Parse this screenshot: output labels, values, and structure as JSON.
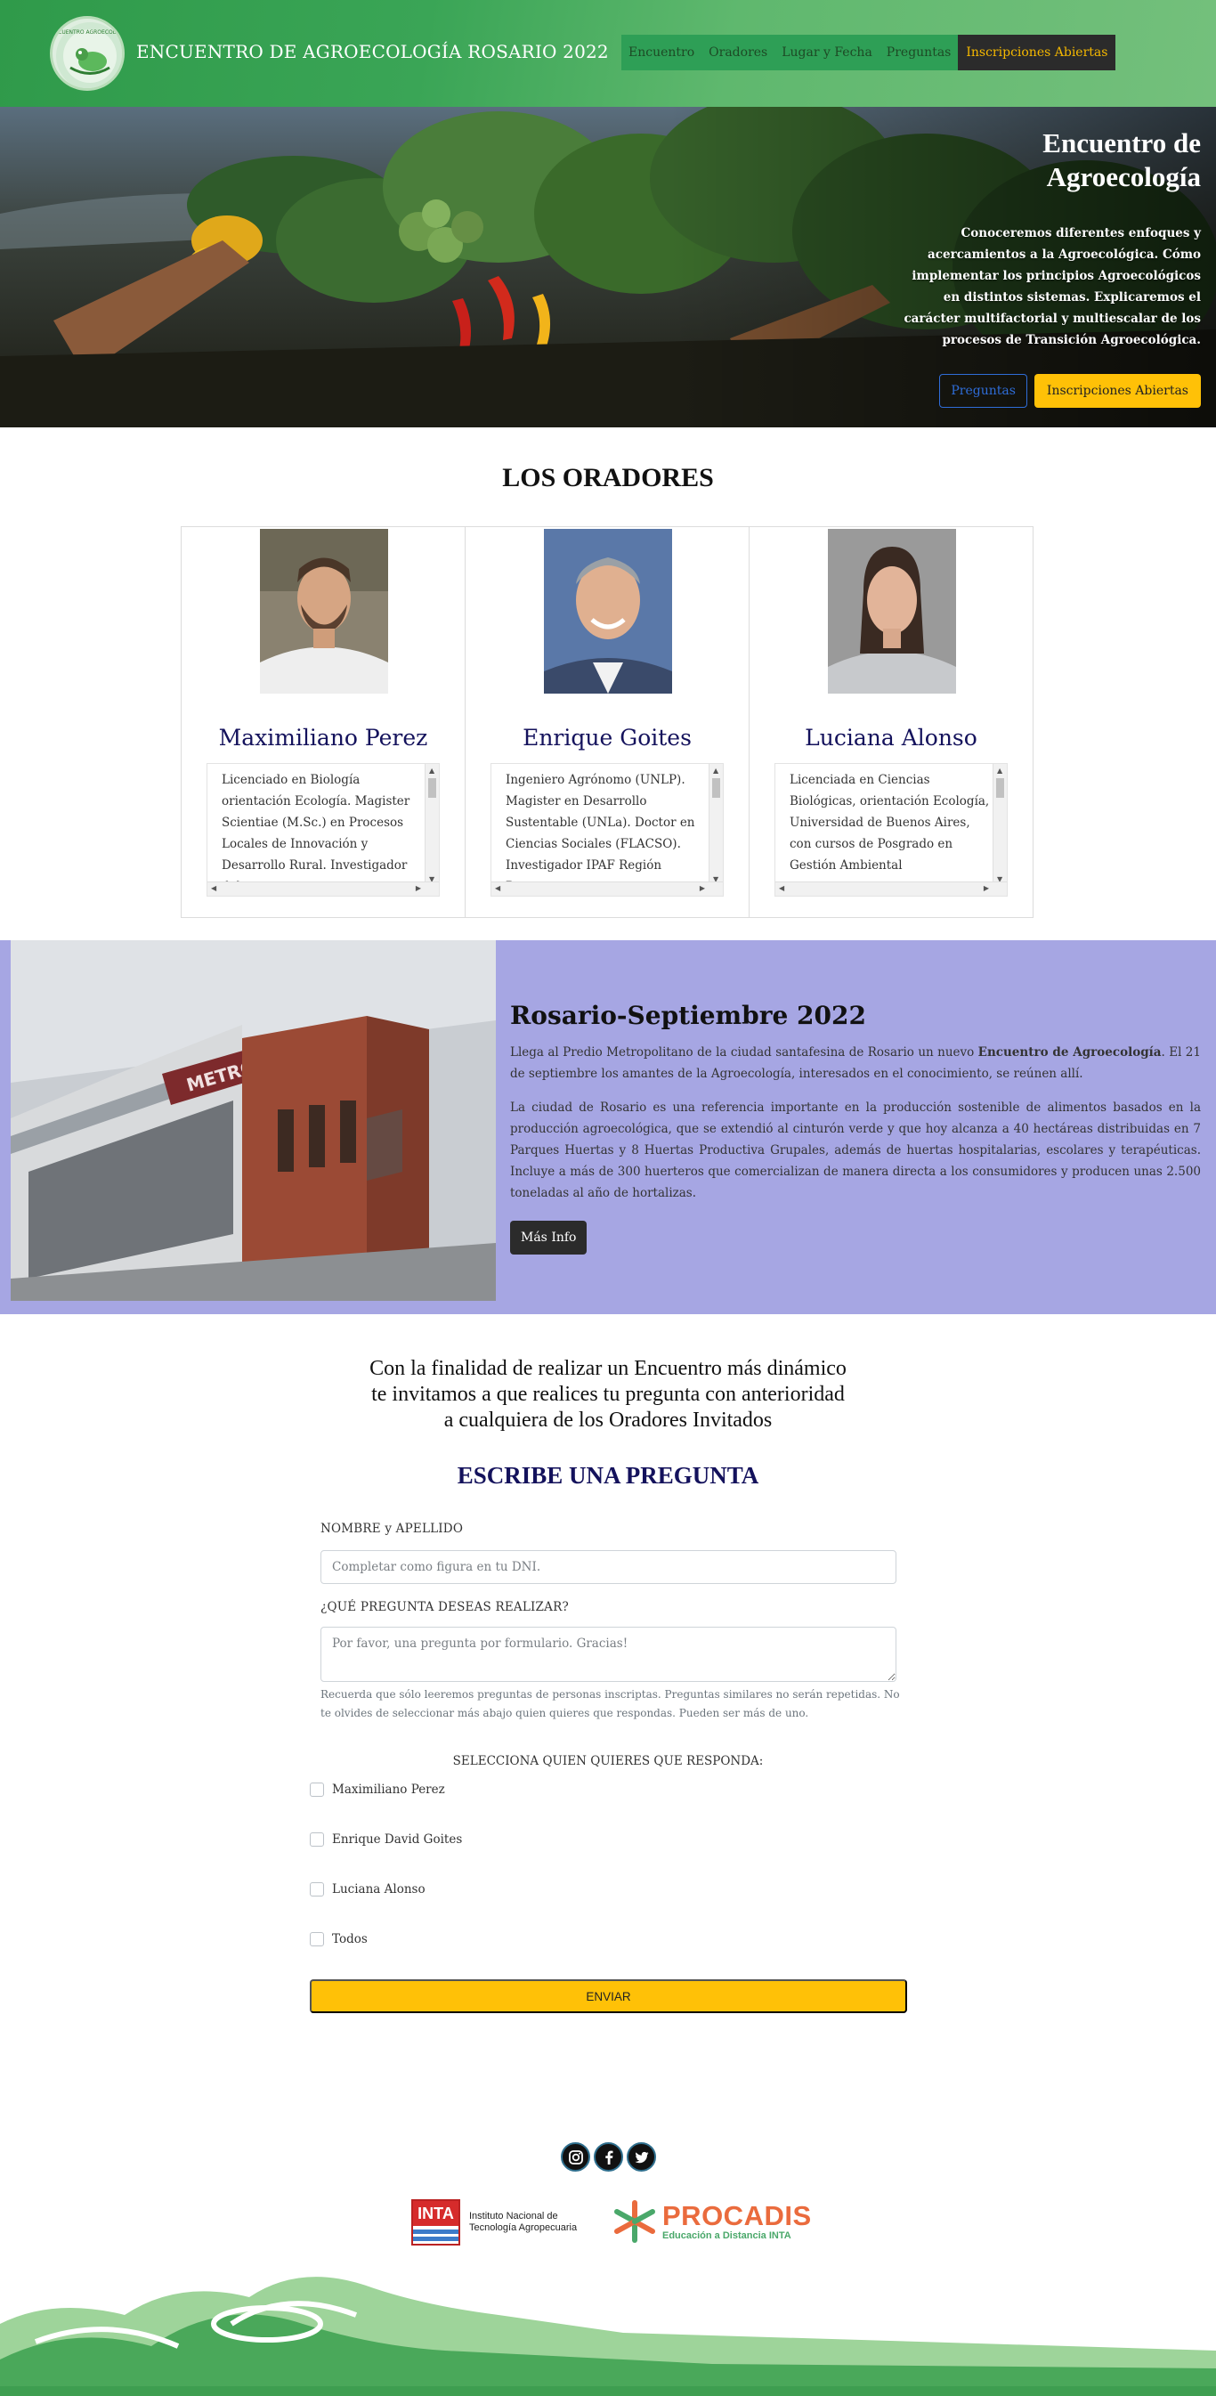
{
  "navbar": {
    "brand_title": "ENCUENTRO DE AGROECOLOGÍA ROSARIO 2022",
    "links": [
      "Encuentro",
      "Oradores",
      "Lugar y Fecha",
      "Preguntas"
    ],
    "cta_label": "Inscripciones Abiertas"
  },
  "hero": {
    "title": "Encuentro de Agroecología",
    "text": "Conoceremos diferentes enfoques y acercamientos a la Agroecológica. Cómo implementar los principios Agroecológicos en distintos sistemas. Explicaremos el carácter multifactorial y multiescalar de los procesos de Transición Agroecológica.",
    "btn_questions": "Preguntas",
    "btn_register": "Inscripciones Abiertas"
  },
  "speakers": {
    "title": "LOS ORADORES",
    "items": [
      {
        "name": "Maximiliano Perez",
        "bio": "Licenciado en Biología orientación Ecología. Magister Scientiae (M.Sc.) en Procesos Locales de Innovación y Desarrollo Rural. Investigador del"
      },
      {
        "name": "Enrique Goites",
        "bio": "Ingeniero Agrónomo (UNLP). Magister en Desarrollo Sustentable (UNLa). Doctor en Ciencias Sociales (FLACSO). Investigador IPAF Región Pampeana"
      },
      {
        "name": "Luciana Alonso",
        "bio": "Licenciada en Ciencias Biológicas, orientación Ecología, Universidad de Buenos Aires, con cursos de Posgrado en Gestión Ambiental"
      }
    ]
  },
  "event": {
    "title": "Rosario-Septiembre 2022",
    "p1_before": "Llega al Predio Metropolitano de la ciudad santafesina de Rosario un nuevo ",
    "p1_strong": "Encuentro de Agroecología",
    "p1_after": ". El 21 de septiembre los amantes de la Agroecología, interesados en el conocimiento, se reúnen allí.",
    "p2": "La ciudad de Rosario es una referencia importante en la producción sostenible de alimentos basados en la producción agroecológica, que se extendió al cinturón verde y que hoy alcanza a 40 hectáreas distribuidas en 7 Parques Huertas y 8 Huertas Productiva Grupales, además de huertas hospitalarias, escolares y terapéuticas. Incluye a más de 300 huerteros que comercializan de manera directa a los consumidores y producen unas 2.500 toneladas al año de hortalizas.",
    "btn_more": "Más Info"
  },
  "form": {
    "intro": [
      "Con la finalidad de realizar un Encuentro más dinámico",
      "te invitamos a que realices tu pregunta con anterioridad",
      "a cualquiera de los Oradores Invitados"
    ],
    "title": "ESCRIBE UNA PREGUNTA",
    "name_label": "NOMBRE y APELLIDO",
    "name_placeholder": "Completar como figura en tu DNI.",
    "question_label": "¿QUÉ PREGUNTA DESEAS REALIZAR?",
    "question_placeholder": "Por favor, una pregunta por formulario. Gracias!",
    "help": "Recuerda que sólo leeremos preguntas de personas inscriptas. Preguntas similares no serán repetidas. No te olvides de seleccionar más abajo quien quieres que respondas. Pueden ser más de uno.",
    "select_label": "SELECCIONA QUIEN QUIERES QUE RESPONDA:",
    "options": [
      "Maximiliano Perez",
      "Enrique David Goites",
      "Luciana Alonso",
      "Todos"
    ],
    "submit": "ENVIAR"
  },
  "footer": {
    "social_icons": [
      "instagram-icon",
      "facebook-icon",
      "twitter-icon"
    ],
    "inta_abbr": "INTA",
    "inta_name": [
      "Instituto Nacional de",
      "Tecnología Agropecuaria"
    ],
    "procadis_name": "PROCADIS",
    "procadis_sub": "Educación a Distancia INTA"
  },
  "colors": {
    "nav_green": "#3aa556",
    "cta_yellow": "#ffc107",
    "event_bg": "#a6a6e3",
    "speaker_name": "#14125c"
  }
}
